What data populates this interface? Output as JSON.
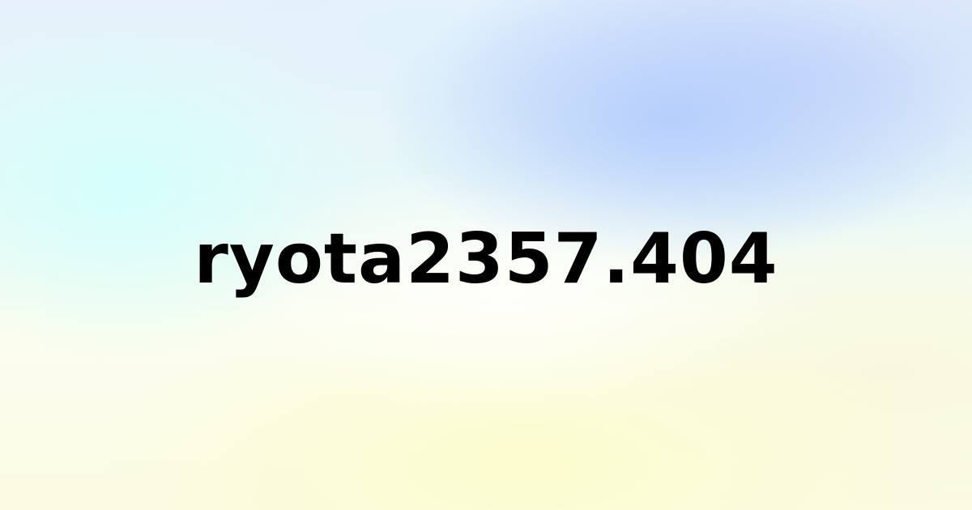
{
  "title": "ryota2357.404",
  "colors": {
    "text": "#000000",
    "gradient_blue": "#b4cdfc",
    "gradient_cyan": "#d4fffc",
    "gradient_yellow": "#fcfccd"
  }
}
